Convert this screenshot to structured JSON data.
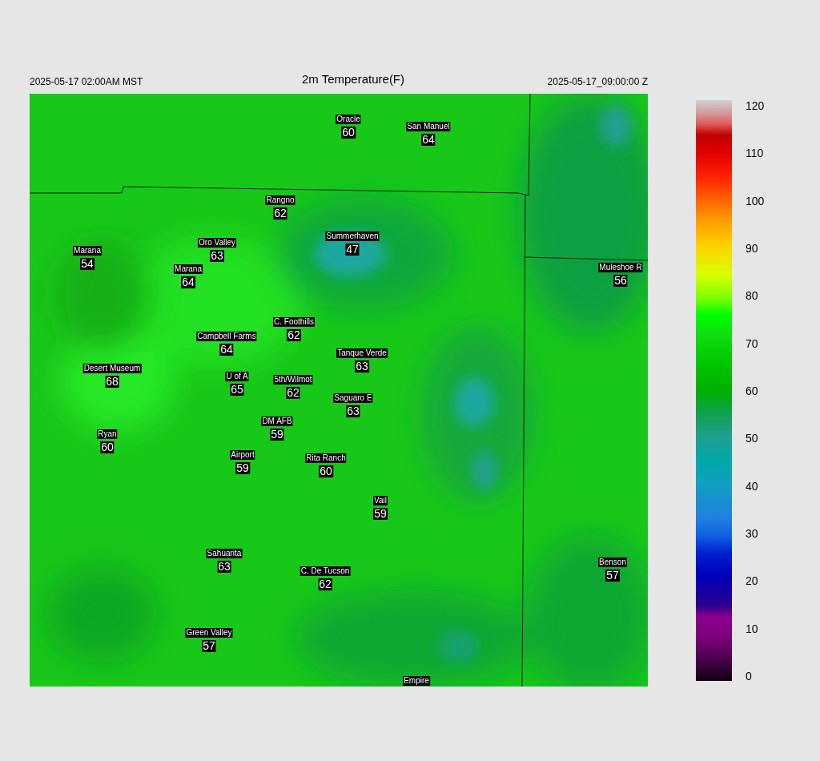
{
  "header": {
    "valid_local": "2025-05-17 02:00AM MST",
    "title": "2m Temperature(F)",
    "valid_utc": "2025-05-17_09:00:00 Z"
  },
  "stations": [
    {
      "name": "Oracle",
      "value": "60"
    },
    {
      "name": "San Manuel",
      "value": "64"
    },
    {
      "name": "Rangno",
      "value": "62"
    },
    {
      "name": "Summerhaven",
      "value": "47"
    },
    {
      "name": "Marana",
      "value": "54"
    },
    {
      "name": "Oro Valley",
      "value": "63"
    },
    {
      "name": "Marana",
      "value": "64"
    },
    {
      "name": "Muleshoe R",
      "value": "56"
    },
    {
      "name": "C. Foothills",
      "value": "62"
    },
    {
      "name": "Campbell Farms",
      "value": "64"
    },
    {
      "name": "Tanque Verde",
      "value": "63"
    },
    {
      "name": "Desert Museum",
      "value": "68"
    },
    {
      "name": "U of A",
      "value": "65"
    },
    {
      "name": "5th/Wilmot",
      "value": "62"
    },
    {
      "name": "Saguaro E",
      "value": "63"
    },
    {
      "name": "DM AFB",
      "value": "59"
    },
    {
      "name": "Ryan",
      "value": "60"
    },
    {
      "name": "Airport",
      "value": "59"
    },
    {
      "name": "Rita Ranch",
      "value": "60"
    },
    {
      "name": "Vail",
      "value": "59"
    },
    {
      "name": "Sahuarita",
      "value": "63"
    },
    {
      "name": "Benson",
      "value": "57"
    },
    {
      "name": "C. De Tucson",
      "value": "62"
    },
    {
      "name": "Green Valley",
      "value": "57"
    },
    {
      "name": "Empire"
    }
  ],
  "colorbar": {
    "ticks": [
      "120",
      "110",
      "100",
      "90",
      "80",
      "70",
      "60",
      "50",
      "40",
      "30",
      "20",
      "10",
      "0"
    ]
  }
}
